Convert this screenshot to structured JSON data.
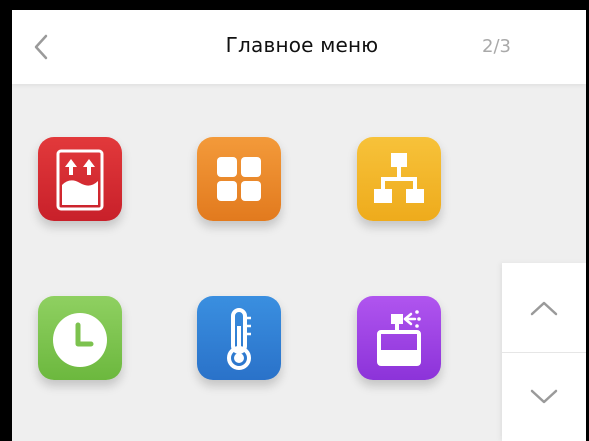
{
  "header": {
    "title": "Главное меню",
    "page_indicator": "2/3",
    "back_icon": "chevron-left-icon"
  },
  "menu": {
    "tiles": [
      {
        "icon": "lift-up-icon",
        "color": "#d62c33"
      },
      {
        "icon": "grid-icon",
        "color": "#ea8a2b"
      },
      {
        "icon": "network-icon",
        "color": "#f3b62b"
      },
      {
        "icon": "clock-icon",
        "color": "#7cc24e"
      },
      {
        "icon": "thermometer-icon",
        "color": "#2f80d6"
      },
      {
        "icon": "sprayer-icon",
        "color": "#9b44e4"
      }
    ]
  },
  "scroll": {
    "up_icon": "chevron-up-icon",
    "down_icon": "chevron-down-icon"
  }
}
